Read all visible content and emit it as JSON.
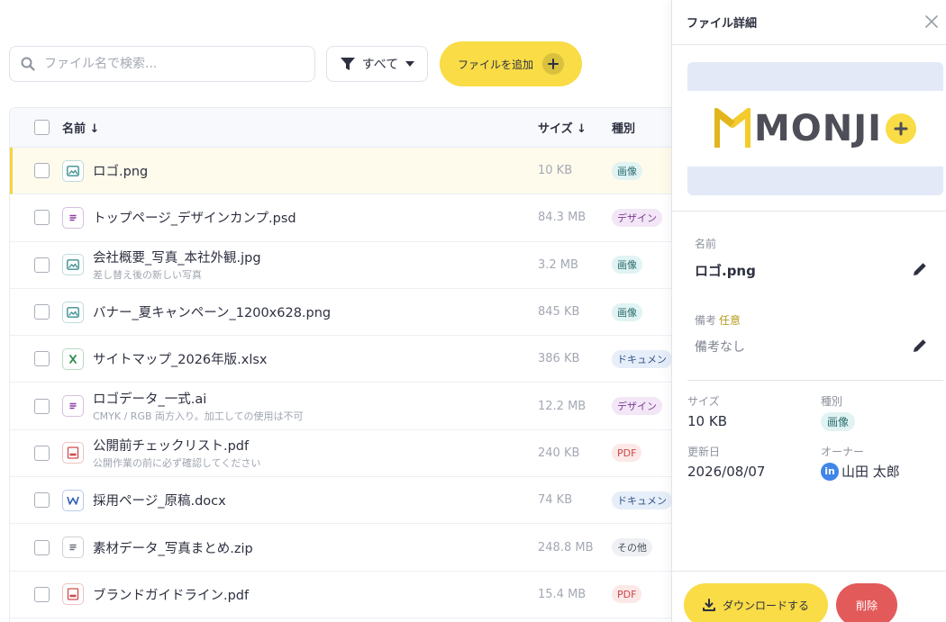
{
  "toolbar": {
    "search_placeholder": "ファイル名で検索...",
    "filter_label": "すべて",
    "add_label": "ファイルを追加"
  },
  "table": {
    "headers": {
      "name": "名前 ↓",
      "size": "サイズ ↓",
      "type": "種別"
    },
    "rows": [
      {
        "name": "ロゴ.png",
        "note": "",
        "size": "10 KB",
        "type": "画像",
        "kind": "image",
        "selected": true
      },
      {
        "name": "トップページ_デザインカンプ.psd",
        "note": "",
        "size": "84.3 MB",
        "type": "デザイン",
        "kind": "design"
      },
      {
        "name": "会社概要_写真_本社外観.jpg",
        "note": "差し替え後の新しい写真",
        "size": "3.2 MB",
        "type": "画像",
        "kind": "image"
      },
      {
        "name": "バナー_夏キャンペーン_1200x628.png",
        "note": "",
        "size": "845 KB",
        "type": "画像",
        "kind": "image"
      },
      {
        "name": "サイトマップ_2026年版.xlsx",
        "note": "",
        "size": "386 KB",
        "type": "ドキュメン",
        "kind": "excel"
      },
      {
        "name": "ロゴデータ_一式.ai",
        "note": "CMYK / RGB 両方入り。加工しての使用は不可",
        "size": "12.2 MB",
        "type": "デザイン",
        "kind": "design"
      },
      {
        "name": "公開前チェックリスト.pdf",
        "note": "公開作業の前に必ず確認してください",
        "size": "240 KB",
        "type": "PDF",
        "kind": "pdf"
      },
      {
        "name": "採用ページ_原稿.docx",
        "note": "",
        "size": "74 KB",
        "type": "ドキュメン",
        "kind": "word"
      },
      {
        "name": "素材データ_写真まとめ.zip",
        "note": "",
        "size": "248.8 MB",
        "type": "その他",
        "kind": "other"
      },
      {
        "name": "ブランドガイドライン.pdf",
        "note": "",
        "size": "15.4 MB",
        "type": "PDF",
        "kind": "pdf"
      }
    ]
  },
  "panel": {
    "title": "ファイル詳細",
    "logo_text": "MONJI",
    "name_label": "名前",
    "name_value": "ロゴ.png",
    "note_label": "備考",
    "note_optional": "任意",
    "note_value": "備考なし",
    "size_label": "サイズ",
    "size_value": "10 KB",
    "type_label": "種別",
    "type_value": "画像",
    "updated_label": "更新日",
    "updated_value": "2026/08/07",
    "owner_label": "オーナー",
    "owner_value": "山田 太郎",
    "owner_avatar": "in",
    "download_label": "ダウンロードする",
    "delete_label": "削除"
  },
  "colors": {
    "accent": "#f9dc46",
    "danger": "#e35a5a",
    "owner_avatar": "#3f86e8"
  },
  "icons": {
    "image": "image-icon",
    "design": "document-icon",
    "excel": "excel-icon",
    "pdf": "pdf-icon",
    "word": "word-icon",
    "other": "document-icon"
  }
}
